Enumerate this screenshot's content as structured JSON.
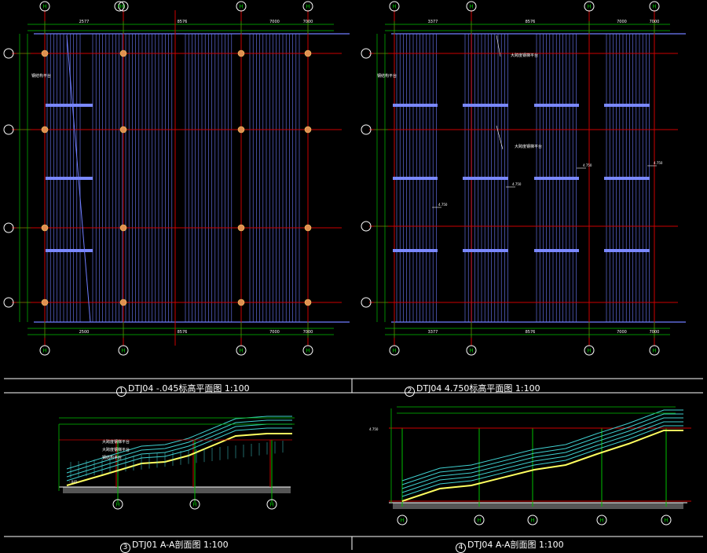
{
  "colors": {
    "background": "#000000",
    "axis": "#cc0000",
    "hatch": "#6f7dff",
    "beam": "#7a88ff",
    "dim": "#00c000",
    "column": "#e09050",
    "stair_rail": "#40d0d0",
    "stair_body": "#ffff60",
    "white": "#ffffff"
  },
  "plan1": {
    "title_number": "1",
    "title": "DTJ04 -.045标高平面图 1:100",
    "top_axes": [
      "H",
      "H",
      "H",
      "H",
      "H"
    ],
    "bottom_axes": [
      "H",
      "H",
      "H",
      "H",
      "H"
    ],
    "row_axes": [
      "J-4",
      "J-3",
      "J-2",
      "J-1"
    ],
    "top_dims": [
      "2577",
      "8576",
      "7000",
      "7000"
    ],
    "bottom_dims": [
      "2500",
      "8576",
      "7000",
      "7000"
    ],
    "side_dims": [
      "14000",
      "7000"
    ],
    "note": "钢结构平台"
  },
  "plan2": {
    "title_number": "2",
    "title": "DTJ04 4.750标高平面图 1:100",
    "top_axes": [
      "H",
      "H",
      "H",
      "H",
      "H",
      "H"
    ],
    "bottom_axes": [
      "H",
      "H",
      "H",
      "H",
      "H",
      "H"
    ],
    "row_axes": [
      "J-4",
      "J-3",
      "J-2",
      "J-1"
    ],
    "top_dims": [
      "3377",
      "8576",
      "7000",
      "7000"
    ],
    "bottom_dims": [
      "3377",
      "8576",
      "7000",
      "7000"
    ],
    "side_dims": [
      "7000",
      "7000",
      "7000"
    ],
    "notes": [
      "大跨度钢梯平台",
      "大跨度钢梯平台",
      "钢结构平台"
    ],
    "elevations": [
      "4.750",
      "4.750",
      "4.750",
      "4.750"
    ]
  },
  "section3": {
    "title_number": "3",
    "title": "DTJ01 A-A剖面图 1:100",
    "axes": [
      "H",
      "H",
      "H"
    ],
    "notes": [
      "大跨度钢梯平台",
      "大跨度钢梯平台",
      "钢结构平台"
    ],
    "elevation": "-.045"
  },
  "section4": {
    "title_number": "4",
    "title": "DTJ04 A-A剖面图 1:100",
    "axes": [
      "H",
      "H",
      "H",
      "H",
      "H"
    ],
    "elevation": "4.750"
  }
}
